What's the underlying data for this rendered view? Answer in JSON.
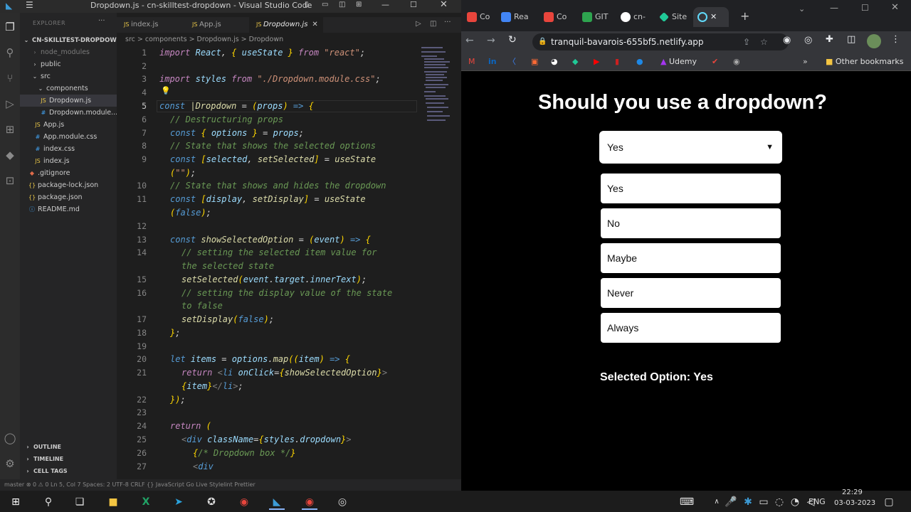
{
  "vscode": {
    "window_title": "Dropdown.js - cn-skilltest-dropdown - Visual Studio Code",
    "explorer_label": "EXPLORER",
    "project": "CN-SKILLTEST-DROPDOWN",
    "tree": [
      {
        "name": "node_modules",
        "kind": "folder"
      },
      {
        "name": "public",
        "kind": "folder"
      },
      {
        "name": "src",
        "kind": "folder"
      },
      {
        "name": "components",
        "kind": "folder"
      },
      {
        "name": "Dropdown.js",
        "kind": "js"
      },
      {
        "name": "Dropdown.module...",
        "kind": "css"
      },
      {
        "name": "App.js",
        "kind": "js"
      },
      {
        "name": "App.module.css",
        "kind": "css"
      },
      {
        "name": "index.css",
        "kind": "css"
      },
      {
        "name": "index.js",
        "kind": "js"
      },
      {
        "name": ".gitignore",
        "kind": "git"
      },
      {
        "name": "package-lock.json",
        "kind": "json"
      },
      {
        "name": "package.json",
        "kind": "json"
      },
      {
        "name": "README.md",
        "kind": "md"
      }
    ],
    "panels": [
      "OUTLINE",
      "TIMELINE",
      "CELL TAGS"
    ],
    "tabs": [
      "index.js",
      "App.js",
      "Dropdown.js"
    ],
    "breadcrumb": "src > components > Dropdown.js > Dropdown",
    "line_numbers": [
      "1",
      "2",
      "3",
      "4",
      "5",
      "6",
      "7",
      "8",
      "9",
      "10",
      "11",
      "12",
      "13",
      "14",
      "15",
      "16",
      "17",
      "18",
      "19",
      "20",
      "21",
      "22",
      "23",
      "24",
      "25",
      "26",
      "27"
    ],
    "status": "master   ⊗ 0 ⚠ 0        Ln 5, Col 7   Spaces: 2   UTF-8   CRLF   {} JavaScript   Go Live   Stylelint   Prettier"
  },
  "browser": {
    "tabs": [
      {
        "label": "Co",
        "color": "#e8453c"
      },
      {
        "label": "Rea",
        "color": "#4285f4"
      },
      {
        "label": "Co",
        "color": "#e8453c"
      },
      {
        "label": "GIT",
        "color": "#2ea44f"
      },
      {
        "label": "cn-",
        "color": "#ffffff"
      },
      {
        "label": "Site",
        "color": "#20c997"
      },
      {
        "label": "",
        "color": "#61dafb"
      }
    ],
    "url": "tranquil-bavarois-655bf5.netlify.app",
    "bookmarks": [
      "Udemy"
    ],
    "other_bookmarks": "Other bookmarks"
  },
  "app": {
    "heading": "Should you use a dropdown?",
    "selected_value": "Yes",
    "options": [
      "Yes",
      "No",
      "Maybe",
      "Never",
      "Always"
    ],
    "selected_text": "Selected Option: Yes"
  },
  "taskbar": {
    "language": "ENG",
    "time": "22:29",
    "date": "03-03-2023"
  }
}
